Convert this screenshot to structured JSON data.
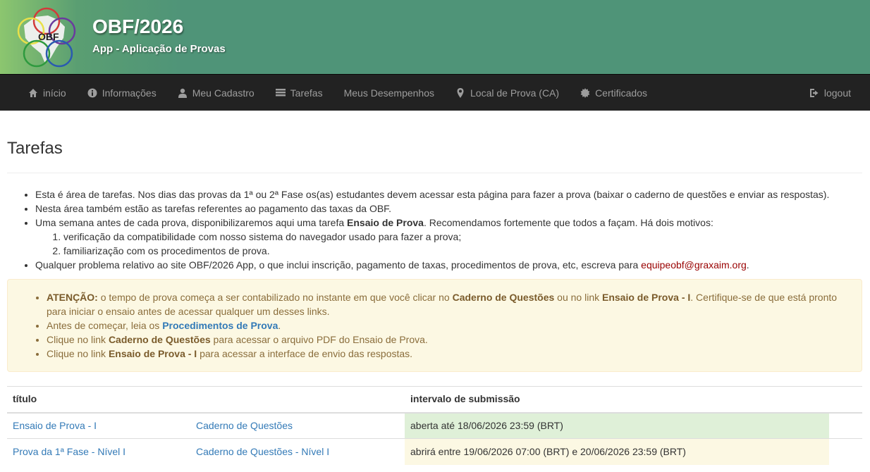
{
  "header": {
    "logo_text": "OBF",
    "title": "OBF/2026",
    "subtitle": "App - Aplicação de Provas"
  },
  "nav": {
    "items": [
      {
        "label": "início",
        "icon": "home-icon"
      },
      {
        "label": "Informações",
        "icon": "info-icon"
      },
      {
        "label": "Meu Cadastro",
        "icon": "user-icon"
      },
      {
        "label": "Tarefas",
        "icon": "list-icon"
      },
      {
        "label": "Meus Desempenhos",
        "icon": ""
      },
      {
        "label": "Local de Prova (CA)",
        "icon": "map-marker-icon"
      },
      {
        "label": "Certificados",
        "icon": "certificate-icon"
      }
    ],
    "logout": "logout"
  },
  "page": {
    "title": "Tarefas",
    "info": {
      "item1": "Esta é área de tarefas. Nos dias das provas da 1ª ou 2ª Fase os(as) estudantes devem acessar esta página para fazer a prova (baixar o caderno de questões e enviar as respostas).",
      "item2": "Nesta área também estão as tarefas referentes ao pagamento das taxas da OBF.",
      "item3_pre": "Uma semana antes de cada prova, disponibilizaremos aqui uma tarefa ",
      "item3_bold": "Ensaio de Prova",
      "item3_post": ". Recomendamos fortemente que todos a façam. Há dois motivos:",
      "sub1": "verificação da compatibilidade com nosso sistema do navegador usado para fazer a prova;",
      "sub2": "familiarização com os procedimentos de prova.",
      "item4_pre": "Qualquer problema relativo ao site OBF/2026 App, o que inclui inscrição, pagamento de taxas, procedimentos de prova, etc, escreva para ",
      "item4_email": "equipeobf@graxaim.org",
      "item4_post": "."
    },
    "alert": {
      "a1_bold": "ATENÇÃO:",
      "a1_text1": " o tempo de prova começa a ser contabilizado no instante em que você clicar no ",
      "a1_bold2": "Caderno de Questões",
      "a1_text2": " ou no link ",
      "a1_bold3": "Ensaio de Prova - I",
      "a1_text3": ". Certifique-se de que está pronto para iniciar o ensaio antes de acessar qualquer um desses links.",
      "a2_text": "Antes de começar, leia os ",
      "a2_link": "Procedimentos de Prova",
      "a2_post": ".",
      "a3_text": "Clique no link ",
      "a3_bold": "Caderno de Questões",
      "a3_post": " para acessar o arquivo PDF do Ensaio de Prova.",
      "a4_text": "Clique no link ",
      "a4_bold": "Ensaio de Prova - I",
      "a4_post": " para acessar a interface de envio das respostas."
    },
    "table": {
      "headers": {
        "title": "título",
        "interval": "intervalo de submissão"
      },
      "rows": [
        {
          "task": "Ensaio de Prova - I",
          "doc": "Caderno de Questões",
          "interval": "aberta até 18/06/2026 23:59 (BRT)",
          "status_color": "#dff0d8"
        },
        {
          "task": "Prova da 1ª Fase - Nível I",
          "doc": "Caderno de Questões - Nível I",
          "interval": "abrirá entre 19/06/2026 07:00 (BRT) e 20/06/2026 23:59 (BRT)",
          "status_color": "#fcf8e3"
        }
      ]
    }
  }
}
